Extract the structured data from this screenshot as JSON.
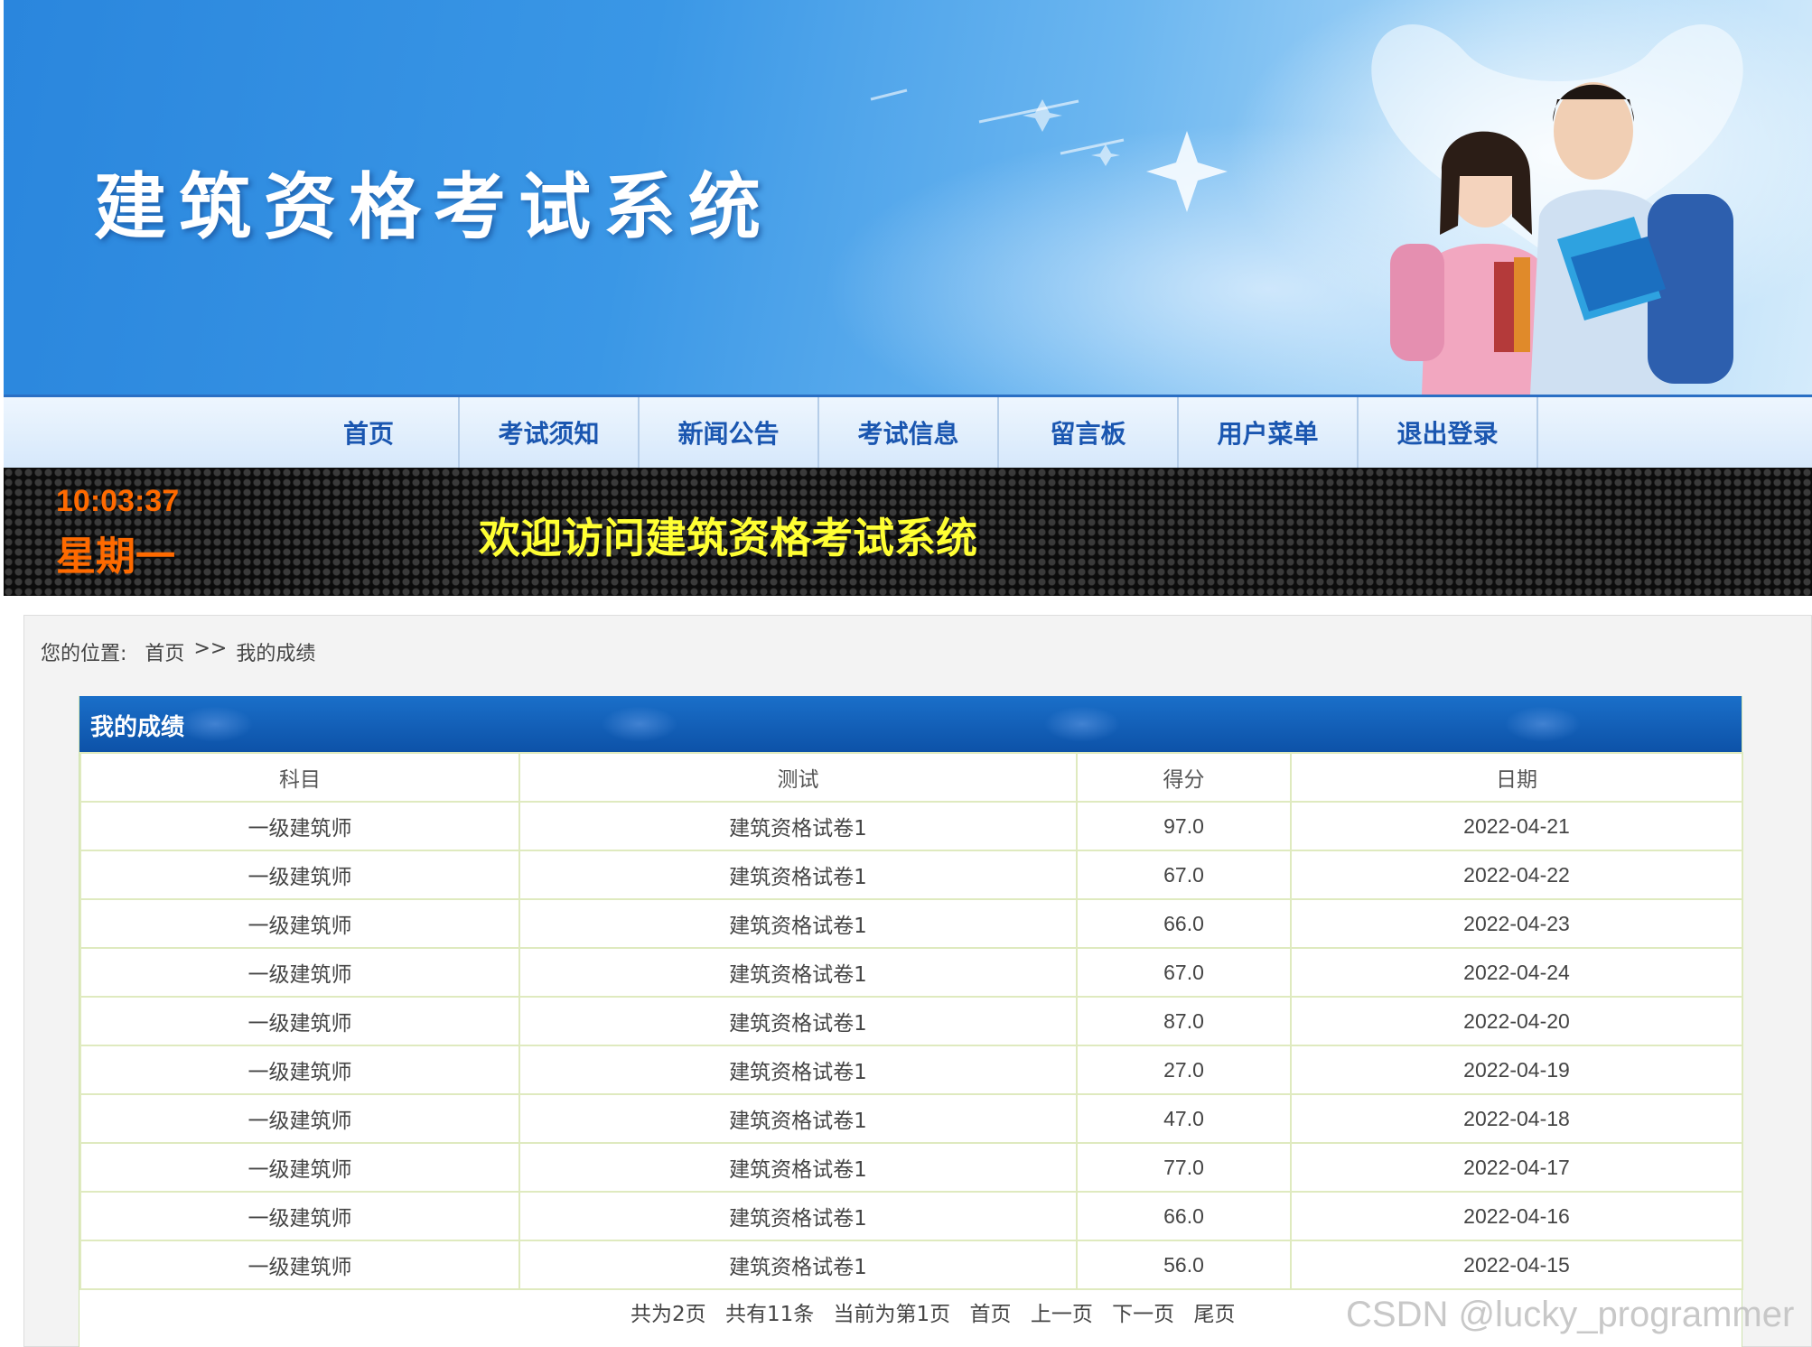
{
  "banner": {
    "title": "建筑资格考试系统"
  },
  "nav": {
    "items": [
      {
        "label": "首页"
      },
      {
        "label": "考试须知"
      },
      {
        "label": "新闻公告"
      },
      {
        "label": "考试信息"
      },
      {
        "label": "留言板"
      },
      {
        "label": "用户菜单"
      },
      {
        "label": "退出登录"
      }
    ]
  },
  "ledbar": {
    "time": "10:03:37",
    "weekday": "星期一",
    "welcome": "欢迎访问建筑资格考试系统"
  },
  "breadcrumb": {
    "prefix": "您的位置:",
    "home": "首页",
    "separator": ">>",
    "current": "我的成绩"
  },
  "panel": {
    "title": "我的成绩",
    "columns": [
      "科目",
      "测试",
      "得分",
      "日期"
    ],
    "rows": [
      [
        "一级建筑师",
        "建筑资格试卷1",
        "97.0",
        "2022-04-21"
      ],
      [
        "一级建筑师",
        "建筑资格试卷1",
        "67.0",
        "2022-04-22"
      ],
      [
        "一级建筑师",
        "建筑资格试卷1",
        "66.0",
        "2022-04-23"
      ],
      [
        "一级建筑师",
        "建筑资格试卷1",
        "67.0",
        "2022-04-24"
      ],
      [
        "一级建筑师",
        "建筑资格试卷1",
        "87.0",
        "2022-04-20"
      ],
      [
        "一级建筑师",
        "建筑资格试卷1",
        "27.0",
        "2022-04-19"
      ],
      [
        "一级建筑师",
        "建筑资格试卷1",
        "47.0",
        "2022-04-18"
      ],
      [
        "一级建筑师",
        "建筑资格试卷1",
        "77.0",
        "2022-04-17"
      ],
      [
        "一级建筑师",
        "建筑资格试卷1",
        "66.0",
        "2022-04-16"
      ],
      [
        "一级建筑师",
        "建筑资格试卷1",
        "56.0",
        "2022-04-15"
      ]
    ]
  },
  "pager": {
    "total_pages": "共为2页",
    "total_items": "共有11条",
    "current_page": "当前为第1页",
    "first": "首页",
    "prev": "上一页",
    "next": "下一页",
    "last": "尾页"
  },
  "watermark": "CSDN @lucky_programmer",
  "colors": {
    "nav_text": "#1a56b0",
    "clock": "#ff6a00",
    "welcome": "#ffff33",
    "panel_header": "#0d52a8",
    "table_border": "#dfeabf"
  }
}
